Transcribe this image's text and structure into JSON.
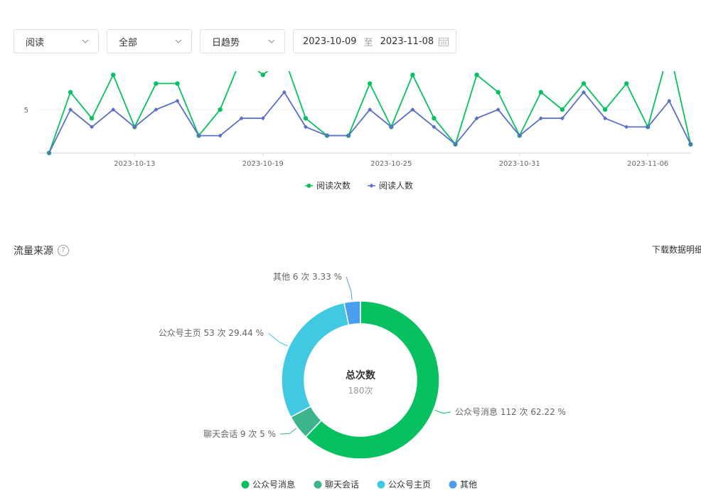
{
  "filters": {
    "metric": "阅读",
    "scope": "全部",
    "granularity": "日趋势",
    "date_start": "2023-10-09",
    "date_sep": "至",
    "date_end": "2023-11-08"
  },
  "section": {
    "title": "流量来源",
    "help": "?",
    "download": "下载数据明细"
  },
  "chart_data": [
    {
      "type": "line",
      "x": [
        "2023-10-09",
        "2023-10-10",
        "2023-10-11",
        "2023-10-12",
        "2023-10-13",
        "2023-10-14",
        "2023-10-15",
        "2023-10-16",
        "2023-10-17",
        "2023-10-18",
        "2023-10-19",
        "2023-10-20",
        "2023-10-21",
        "2023-10-22",
        "2023-10-23",
        "2023-10-24",
        "2023-10-25",
        "2023-10-26",
        "2023-10-27",
        "2023-10-28",
        "2023-10-29",
        "2023-10-30",
        "2023-10-31",
        "2023-11-01",
        "2023-11-02",
        "2023-11-03",
        "2023-11-04",
        "2023-11-05",
        "2023-11-06",
        "2023-11-07",
        "2023-11-08"
      ],
      "x_ticks": [
        "2023-10-13",
        "2023-10-19",
        "2023-10-25",
        "2023-10-31",
        "2023-11-06"
      ],
      "y_ticks": [
        5
      ],
      "series": [
        {
          "name": "阅读次数",
          "color": "#07c160",
          "values": [
            0,
            7,
            4,
            9,
            3,
            8,
            8,
            2,
            5,
            11,
            9,
            11,
            4,
            2,
            2,
            8,
            3,
            9,
            4,
            1,
            9,
            7,
            2,
            7,
            5,
            8,
            5,
            8,
            3,
            12,
            1
          ]
        },
        {
          "name": "阅读人数",
          "color": "#5b6fc6",
          "values": [
            0,
            5,
            3,
            5,
            3,
            5,
            6,
            2,
            2,
            4,
            4,
            7,
            3,
            2,
            2,
            5,
            3,
            5,
            3,
            1,
            4,
            5,
            2,
            4,
            4,
            7,
            4,
            3,
            3,
            6,
            1
          ]
        }
      ],
      "legend": "bottom"
    },
    {
      "type": "pie",
      "center_title": "总次数",
      "center_value": "180次",
      "slices": [
        {
          "name": "公众号消息",
          "value": 112,
          "label": "公众号消息 112 次 62.22 %",
          "color": "#07c160"
        },
        {
          "name": "聊天会话",
          "value": 9,
          "label": "聊天会话 9 次 5 %",
          "color": "#3cb48c"
        },
        {
          "name": "公众号主页",
          "value": 53,
          "label": "公众号主页 53 次 29.44 %",
          "color": "#40c9e0"
        },
        {
          "name": "其他",
          "value": 6,
          "label": "其他 6 次 3.33 %",
          "color": "#4a9ff0"
        }
      ],
      "legend": "bottom"
    }
  ]
}
